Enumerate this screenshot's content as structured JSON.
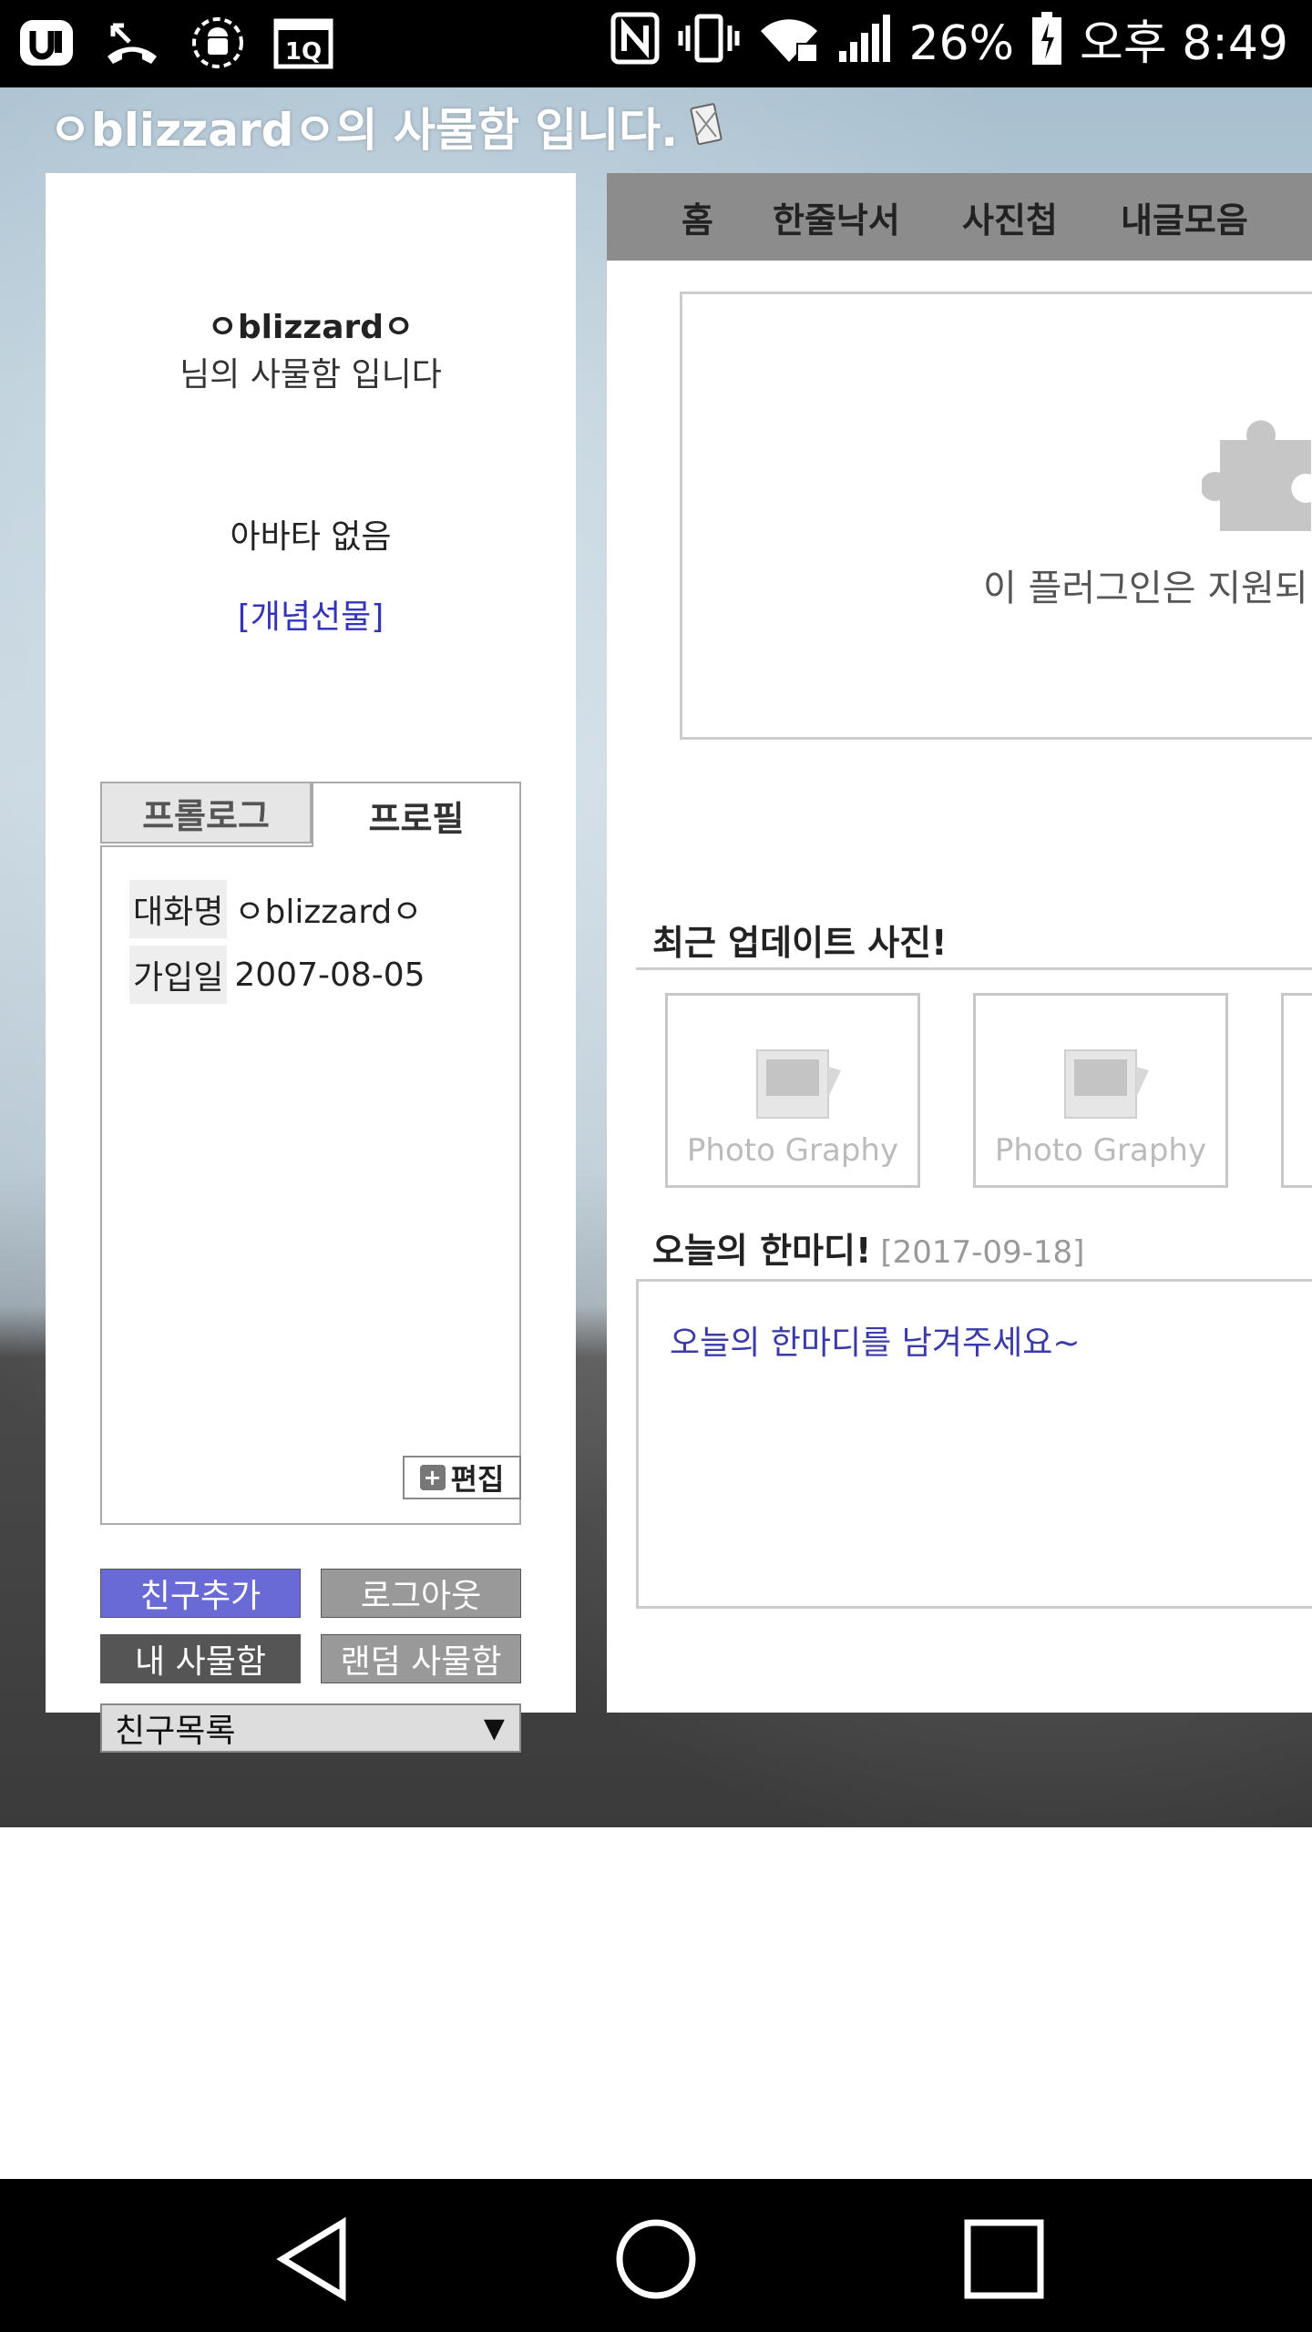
{
  "status_bar": {
    "battery": "26%",
    "time": "오후 8:49",
    "icons": [
      "u-plus-icon",
      "missed-call-icon",
      "android-debug-icon",
      "calendar-icon",
      "nfc-icon",
      "vibrate-icon",
      "wifi-icon",
      "signal-icon",
      "battery-icon"
    ]
  },
  "page": {
    "title": "ㅇblizzardㅇ의 사물함 입니다."
  },
  "left_panel": {
    "owner_name": "ㅇblizzardㅇ",
    "owner_sub": "님의 사물함 입니다",
    "avatar_text": "아바타 없음",
    "gift_link": "[개념선물]",
    "tabs": [
      "프롤로그",
      "프로필"
    ],
    "profile": [
      {
        "label": "대화명",
        "value": "ㅇblizzardㅇ"
      },
      {
        "label": "가입일",
        "value": "2007-08-05"
      }
    ],
    "edit_label": "편집",
    "buttons": {
      "add_friend": "친구추가",
      "logout": "로그아웃",
      "my_locker": "내 사물함",
      "random_locker": "랜덤 사물함"
    },
    "friend_select": "친구목록"
  },
  "right_panel": {
    "nav": [
      "홈",
      "한줄낙서",
      "사진첩",
      "내글모음"
    ],
    "plugin_message": "이 플러그인은 지원되",
    "recent_photos_title": "최근 업데이트 사진!",
    "photo_label": "Photo Graphy",
    "today_title": "오늘의 한마디!",
    "today_date": "[2017-09-18]",
    "today_placeholder": "오늘의 한마디를 남겨주세요~"
  },
  "colors": {
    "accent_blue": "#6a6ad6",
    "link_blue": "#3333bb",
    "nav_gray": "#8c8c8c"
  }
}
